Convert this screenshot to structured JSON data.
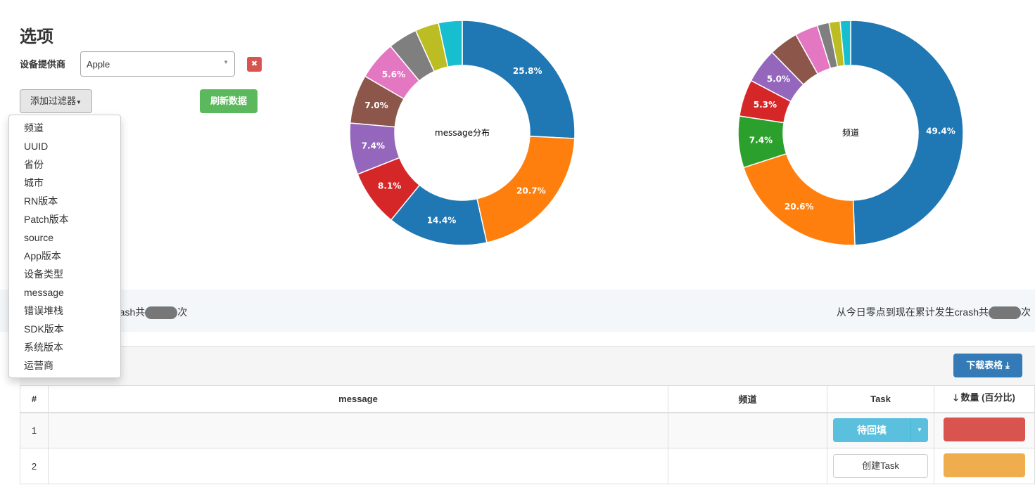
{
  "options": {
    "title": "选项",
    "vendor_label": "设备提供商",
    "vendor_value": "Apple",
    "remove_icon": "close-icon",
    "add_filter": "添加过滤器",
    "refresh": "刷新数据"
  },
  "filter_menu": [
    "频道",
    "UUID",
    "省份",
    "城市",
    "RN版本",
    "Patch版本",
    "source",
    "App版本",
    "设备类型",
    "message",
    "错误堆栈",
    "SDK版本",
    "系统版本",
    "运营商"
  ],
  "info": {
    "left_text": "rash共",
    "left_suffix": "次",
    "right_text": "从今日零点到现在累计发生crash共",
    "right_suffix": "次"
  },
  "download": {
    "label": "下载表格",
    "icon": "download-icon"
  },
  "table": {
    "headers": [
      "#",
      "message",
      "频道",
      "Task",
      "数量 (百分比)"
    ],
    "sort_icon": "arrow-down-icon",
    "rows": [
      {
        "index": "1",
        "task": "待回填",
        "bar_color": "#d9534f"
      },
      {
        "index": "2",
        "task": "创建Task",
        "bar_color": "#f0ad4e"
      }
    ]
  },
  "chart_data": [
    {
      "type": "pie",
      "title": "message分布",
      "colors": [
        "#1f77b4",
        "#ff7f0e",
        "#1f77b4",
        "#d62728",
        "#9467bd",
        "#8c564b",
        "#e377c2",
        "#7f7f7f",
        "#bcbd22",
        "#17becf"
      ],
      "values": [
        25.8,
        20.7,
        14.4,
        8.1,
        7.4,
        7.0,
        5.6,
        4.2,
        3.4,
        3.4
      ],
      "labels": [
        "25.8%",
        "20.7%",
        "14.4%",
        "8.1%",
        "7.4%",
        "7.0%",
        "5.6%",
        "",
        "",
        ""
      ]
    },
    {
      "type": "pie",
      "title": "频道",
      "colors": [
        "#1f77b4",
        "#ff7f0e",
        "#2ca02c",
        "#d62728",
        "#9467bd",
        "#8c564b",
        "#e377c2",
        "#7f7f7f",
        "#bcbd22",
        "#17becf"
      ],
      "values": [
        49.4,
        20.6,
        7.4,
        5.3,
        5.0,
        4.2,
        3.3,
        1.7,
        1.6,
        1.5
      ],
      "labels": [
        "49.4%",
        "20.6%",
        "7.4%",
        "5.3%",
        "5.0%",
        "",
        "",
        "",
        "",
        ""
      ]
    }
  ]
}
